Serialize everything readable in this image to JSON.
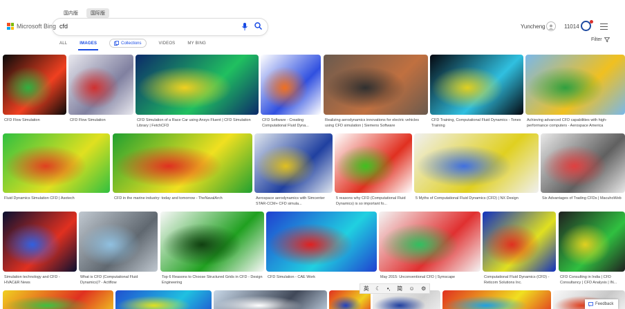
{
  "top_tabs": [
    {
      "label": "国内版",
      "active": false
    },
    {
      "label": "国际版",
      "active": true
    }
  ],
  "brand": {
    "name": "Microsoft Bing",
    "colors": [
      "#f25022",
      "#7fba00",
      "#00a4ef",
      "#ffb900"
    ]
  },
  "search": {
    "value": "cfd"
  },
  "account": {
    "user_name": "Yuncheng",
    "points": "11014"
  },
  "nav": {
    "items": [
      {
        "label": "ALL",
        "active": false
      },
      {
        "label": "IMAGES",
        "active": true
      },
      {
        "label": "Collections",
        "active": false
      },
      {
        "label": "VIDEOS",
        "active": false
      },
      {
        "label": "MY BING",
        "active": false
      }
    ]
  },
  "filter_label": "Filter",
  "accent_color": "#174ae4",
  "results": [
    {
      "caption": "CFD Flow Simulation",
      "colors": [
        "#0a0a0a",
        "#f04020",
        "#30b040"
      ]
    },
    {
      "caption": "CFD Flow Simulation",
      "colors": [
        "#e8e8ee",
        "#8080a0",
        "#d03030"
      ]
    },
    {
      "caption": "CFD Simulation of a Race Car using Ansys Fluent | CFD Simulation Library | FetchCFD",
      "colors": [
        "#0c2a6a",
        "#20c060",
        "#f0d020"
      ]
    },
    {
      "caption": "CFD Software - Creating Computational Fluid Dyna...",
      "colors": [
        "#ffffff",
        "#3050e0",
        "#f07020"
      ]
    },
    {
      "caption": "Realizing aerodynamics innovations for electric vehicles using CFD simulation | Siemens Software",
      "colors": [
        "#6a5a4e",
        "#c07040",
        "#303030"
      ]
    },
    {
      "caption": "CFD Training, Computational Fluid Dynamics - Tonex Training",
      "colors": [
        "#050810",
        "#30c0e0",
        "#e0d020"
      ]
    },
    {
      "caption": "Achieving advanced CFD capabilities with high-performance computers - Aerospace America",
      "colors": [
        "#7ab8e8",
        "#f0c020",
        "#30a040"
      ]
    },
    {
      "caption": "Fluid Dynamics Simulation CFD | Asotech",
      "colors": [
        "#30c040",
        "#e0e020",
        "#e04020"
      ]
    },
    {
      "caption": "CFD in the marine industry: today and tomorrow - TheNavalArch",
      "colors": [
        "#20a030",
        "#f0e020",
        "#e03020"
      ]
    },
    {
      "caption": "Aerospace aerodynamics with Simcenter STAR-CCM+ CFD simula...",
      "colors": [
        "#dfe6ee",
        "#2040a0",
        "#e0c020"
      ]
    },
    {
      "caption": "5 reasons why CFD (Computational Fluid Dynamics) is so important fo...",
      "colors": [
        "#ffffff",
        "#e03020",
        "#40c020"
      ]
    },
    {
      "caption": "5 Myths of Computational Fluid Dynamics (CFD) | NX Design",
      "colors": [
        "#f0f0f0",
        "#e0d020",
        "#4070e0"
      ]
    },
    {
      "caption": "Six Advantages of Trading CFDs | MacuhoWeb",
      "colors": [
        "#e8e8e8",
        "#606060",
        "#e04040"
      ]
    },
    {
      "caption": "Simulation technology and CFD - HVAC&R News",
      "colors": [
        "#0a1030",
        "#e03020",
        "#3060e0"
      ]
    },
    {
      "caption": "What is CFD (Computational Fluid Dynamics)? - Actiflow",
      "colors": [
        "#c0c8d0",
        "#606870",
        "#90c0e0"
      ]
    },
    {
      "caption": "Top 6 Reasons to Choose Structured Grids in CFD - Design Engineering",
      "colors": [
        "#f8f8f8",
        "#20a020",
        "#104010"
      ]
    },
    {
      "caption": "CFD Simulation - CAE Work",
      "colors": [
        "#2040d0",
        "#20d0e0",
        "#e02020"
      ]
    },
    {
      "caption": "May 2015: Unconventional CFD | Symscape",
      "colors": [
        "#f4f4f4",
        "#e03030",
        "#30c060"
      ]
    },
    {
      "caption": "Computational Fluid Dynamics (CFD) - Reticom Solutions Inc.",
      "colors": [
        "#1030c0",
        "#e0e020",
        "#e03020"
      ]
    },
    {
      "caption": "CFD Consulting in India | CFD Consultancy | CFD Analysis | IN...",
      "colors": [
        "#202020",
        "#30c040",
        "#e0d020"
      ]
    },
    {
      "caption": "",
      "colors": [
        "#f0d020",
        "#e03020",
        "#40c040"
      ]
    },
    {
      "caption": "",
      "colors": [
        "#2050d0",
        "#20c0e0",
        "#e0e020"
      ]
    },
    {
      "caption": "",
      "colors": [
        "#c8d8e8",
        "#404858",
        "#ffffff"
      ]
    },
    {
      "caption": "",
      "colors": [
        "#e03020",
        "#f0d020",
        "#2040c0"
      ]
    },
    {
      "caption": "",
      "colors": [
        "#f4f4f4",
        "#d0d0d0",
        "#2040a0"
      ]
    },
    {
      "caption": "",
      "colors": [
        "#e03020",
        "#f0e020",
        "#20a0e0"
      ]
    },
    {
      "caption": "",
      "colors": [
        "#fafafa",
        "#c8c8c8",
        "#e04020"
      ]
    }
  ],
  "ime": {
    "lang": "英",
    "moon": "☾",
    "punct": "•,",
    "mode": "简",
    "emoji": "☺",
    "settings": "⚙"
  },
  "feedback_label": "Feedback"
}
